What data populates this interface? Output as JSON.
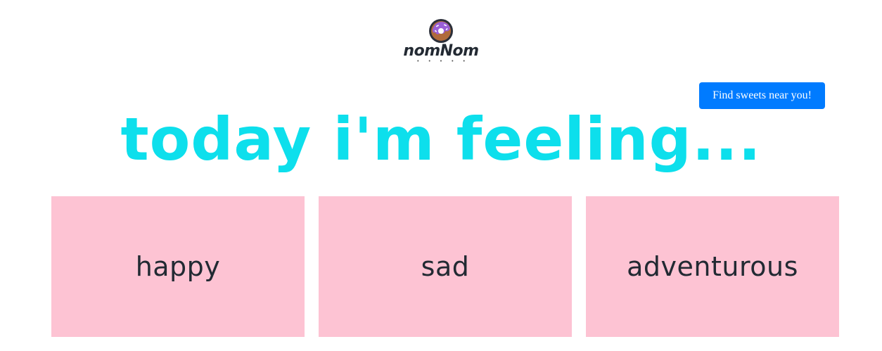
{
  "header": {
    "logo_text": "nomNom",
    "logo_icon": "donut-icon",
    "logo_dots": "• • • • •"
  },
  "find_button_label": "Find sweets near you!",
  "headline": "today i'm feeling...",
  "moods": [
    {
      "label": "happy"
    },
    {
      "label": "sad"
    },
    {
      "label": "adventurous"
    }
  ],
  "colors": {
    "accent": "#0ddfec",
    "button": "#007bff",
    "card": "#fdc3d3",
    "text": "#222a33"
  }
}
